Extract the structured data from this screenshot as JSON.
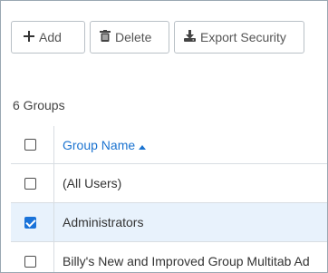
{
  "toolbar": {
    "add_label": "Add",
    "delete_label": "Delete",
    "export_label": "Export Security"
  },
  "group_count": "6 Groups",
  "table": {
    "header": {
      "group_name": "Group Name",
      "sort": "ascending"
    },
    "rows": [
      {
        "name": "(All Users)",
        "checked": false
      },
      {
        "name": "Administrators",
        "checked": true
      },
      {
        "name": "Billy's New and Improved Group Multitab Ad",
        "checked": false
      }
    ]
  },
  "colors": {
    "accent": "#1b73d0",
    "selected_row": "#e8f2fc",
    "checked_box": "#1a73d9"
  }
}
